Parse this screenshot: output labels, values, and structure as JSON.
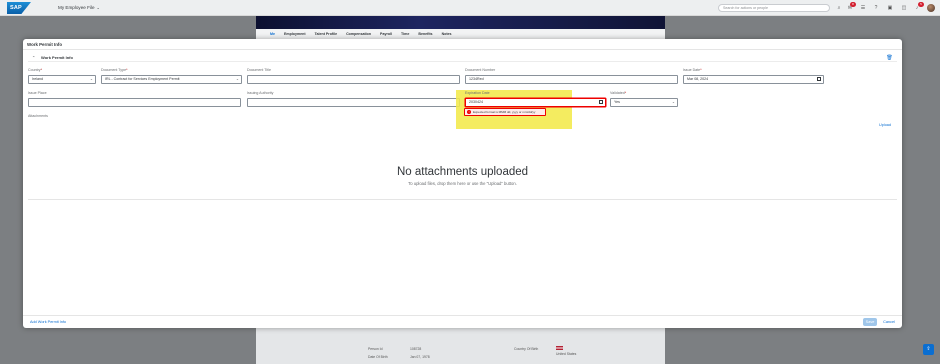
{
  "shell": {
    "logo": "SAP",
    "app_title": "My Employee File",
    "search_placeholder": "Search for actions or people",
    "badge_notifications_1": "8",
    "badge_notifications_2": "5"
  },
  "background_page": {
    "tabs": [
      "Me",
      "Employment",
      "Talent Profile",
      "Compensation",
      "Payroll",
      "Time",
      "Benefits",
      "Notes"
    ],
    "info": {
      "person_id_label": "Person Id",
      "person_id_value": "108728",
      "dob_label": "Date Of Birth",
      "dob_value": "Jan 07, 1978",
      "country_of_birth_label": "Country Of Birth",
      "country_of_birth_value": "United States"
    }
  },
  "dialog": {
    "title": "Work Permit Info",
    "section_title": "Work Permit Info",
    "fields": {
      "country": {
        "label": "Country",
        "value": "Ireland"
      },
      "document_type": {
        "label": "Document Type",
        "value": "IRL - Contract for Services Employment Permit"
      },
      "document_title": {
        "label": "Document Title",
        "value": ""
      },
      "document_number": {
        "label": "Document Number",
        "value": "1234Red"
      },
      "issue_date": {
        "label": "Issue Date",
        "value": "Mar 08, 2024"
      },
      "issue_place": {
        "label": "Issue Place",
        "value": ""
      },
      "issuing_authority": {
        "label": "Issuing Authority",
        "value": ""
      },
      "expiration_date": {
        "label": "Expiration Date",
        "value": "2030424"
      },
      "validated": {
        "label": "Validated",
        "value": "Yes"
      }
    },
    "error_message": "Expected format is MMM dd, yyyy or mm/dd/yy",
    "attachments_label": "Attachments",
    "upload_link": "Upload",
    "empty_title": "No attachments uploaded",
    "empty_subtitle": "To upload files, drop them here or use the \"Upload\" button.",
    "add_link": "Add Work Permit Info",
    "save_label": "Save",
    "cancel_label": "Cancel"
  },
  "colors": {
    "accent": "#0a6ed1",
    "error": "#e00000",
    "highlight": "#f2e94a"
  }
}
